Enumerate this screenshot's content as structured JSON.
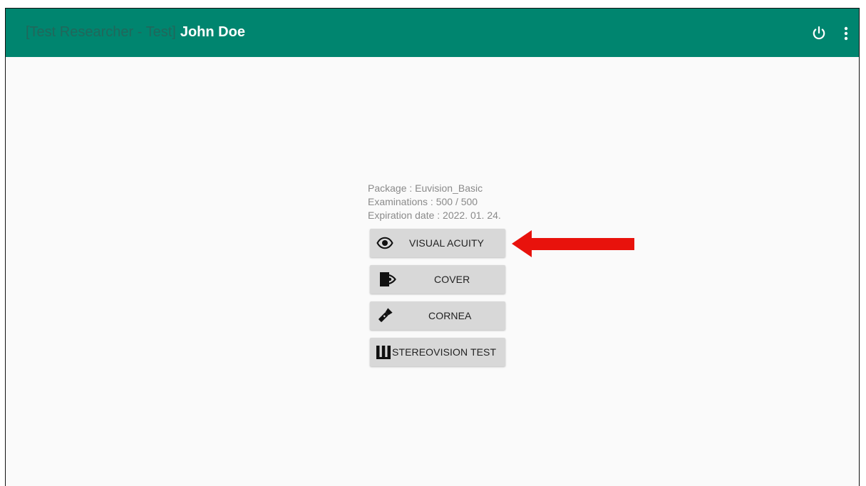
{
  "appbar": {
    "title_prefix": "[Test Researcher  - Test]",
    "user_name": "John Doe",
    "power_icon": "power-icon",
    "menu_icon": "more-vert-icon",
    "color": "#00856f"
  },
  "package_info": {
    "package": "Package : Euvision_Basic",
    "examinations": "Examinations : 500 / 500",
    "expiration": "Expiration date : 2022. 01. 24."
  },
  "tests": [
    {
      "label": "VISUAL ACUITY",
      "icon": "eye-icon"
    },
    {
      "label": "COVER",
      "icon": "cover-eye-icon"
    },
    {
      "label": "CORNEA",
      "icon": "flashlight-icon"
    },
    {
      "label": "STEREOVISION TEST",
      "icon": "stereo-icon"
    }
  ],
  "annotation": {
    "icon": "red-arrow",
    "color": "#e8120c"
  }
}
